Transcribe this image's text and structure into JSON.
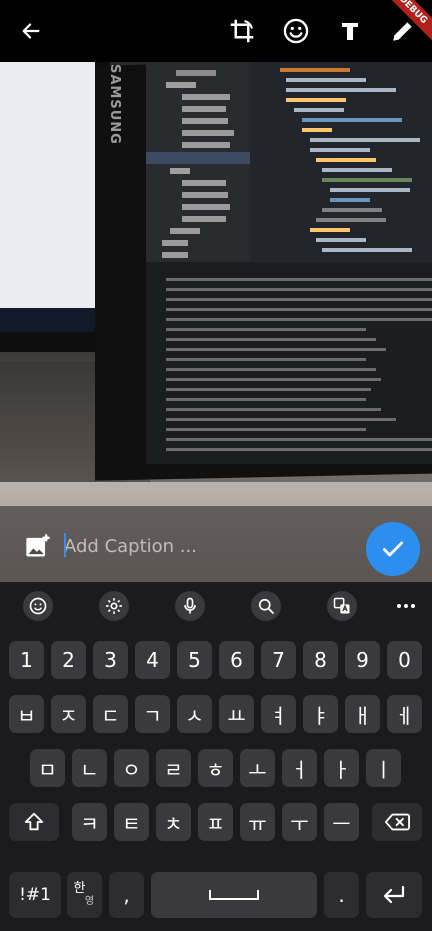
{
  "topbar": {
    "back_icon": "arrow-left-icon",
    "crop_icon": "crop-rotate-icon",
    "emoji_icon": "smiley-icon",
    "text_icon": "text-T-icon",
    "draw_icon": "pencil-icon",
    "debug_banner": "DEBUG"
  },
  "photo": {
    "monitor_brand": "SAMSUNG"
  },
  "caption": {
    "placeholder": "Add Caption ...",
    "add_media_icon": "add-photo-icon",
    "send_icon": "checkmark-icon",
    "send_color": "#2c8ff0"
  },
  "keyboard": {
    "toolbar": [
      "emoji-icon",
      "settings-gear-icon",
      "microphone-icon",
      "search-icon",
      "translate-icon",
      "more-dots-icon"
    ],
    "row_numbers": [
      "1",
      "2",
      "3",
      "4",
      "5",
      "6",
      "7",
      "8",
      "9",
      "0"
    ],
    "row1": [
      "ㅂ",
      "ㅈ",
      "ㄷ",
      "ㄱ",
      "ㅅ",
      "ㅛ",
      "ㅕ",
      "ㅑ",
      "ㅐ",
      "ㅔ"
    ],
    "row2": [
      "ㅁ",
      "ㄴ",
      "ㅇ",
      "ㄹ",
      "ㅎ",
      "ㅗ",
      "ㅓ",
      "ㅏ",
      "ㅣ"
    ],
    "row3": [
      "ㅋ",
      "ㅌ",
      "ㅊ",
      "ㅍ",
      "ㅠ",
      "ㅜ",
      "ㅡ"
    ],
    "shift_icon": "shift-arrow-icon",
    "backspace_icon": "backspace-icon",
    "symbols_label": "!#1",
    "lang_label_top": "한",
    "lang_label_bottom": "영",
    "comma_label": ",",
    "space_icon": "space-bar-icon",
    "period_label": ".",
    "enter_icon": "enter-return-icon"
  }
}
